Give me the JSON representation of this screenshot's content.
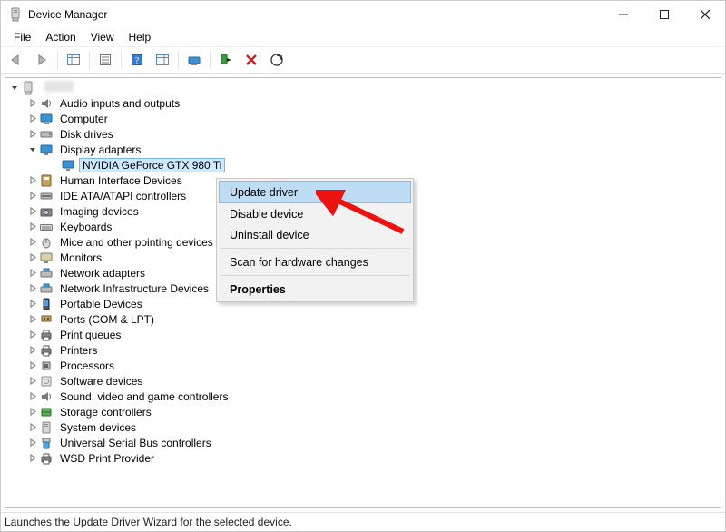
{
  "window": {
    "title": "Device Manager"
  },
  "menu": {
    "file": "File",
    "action": "Action",
    "view": "View",
    "help": "Help"
  },
  "tree": {
    "root": "",
    "items": [
      {
        "label": "Audio inputs and outputs",
        "icon": "speaker"
      },
      {
        "label": "Computer",
        "icon": "computer"
      },
      {
        "label": "Disk drives",
        "icon": "disk"
      },
      {
        "label": "Display adapters",
        "icon": "display",
        "expanded": true,
        "children": [
          {
            "label": "NVIDIA GeForce GTX 980 Ti",
            "icon": "display",
            "selected": true
          }
        ]
      },
      {
        "label": "Human Interface Devices",
        "icon": "hid"
      },
      {
        "label": "IDE ATA/ATAPI controllers",
        "icon": "ide"
      },
      {
        "label": "Imaging devices",
        "icon": "camera"
      },
      {
        "label": "Keyboards",
        "icon": "keyboard"
      },
      {
        "label": "Mice and other pointing devices",
        "icon": "mouse"
      },
      {
        "label": "Monitors",
        "icon": "monitor"
      },
      {
        "label": "Network adapters",
        "icon": "network"
      },
      {
        "label": "Network Infrastructure Devices",
        "icon": "network"
      },
      {
        "label": "Portable Devices",
        "icon": "portable"
      },
      {
        "label": "Ports (COM & LPT)",
        "icon": "port"
      },
      {
        "label": "Print queues",
        "icon": "printer"
      },
      {
        "label": "Printers",
        "icon": "printer"
      },
      {
        "label": "Processors",
        "icon": "cpu"
      },
      {
        "label": "Software devices",
        "icon": "software"
      },
      {
        "label": "Sound, video and game controllers",
        "icon": "sound"
      },
      {
        "label": "Storage controllers",
        "icon": "storage"
      },
      {
        "label": "System devices",
        "icon": "system"
      },
      {
        "label": "Universal Serial Bus controllers",
        "icon": "usb"
      },
      {
        "label": "WSD Print Provider",
        "icon": "printer"
      }
    ]
  },
  "context_menu": {
    "update": "Update driver",
    "disable": "Disable device",
    "uninstall": "Uninstall device",
    "scan": "Scan for hardware changes",
    "properties": "Properties"
  },
  "status": "Launches the Update Driver Wizard for the selected device."
}
